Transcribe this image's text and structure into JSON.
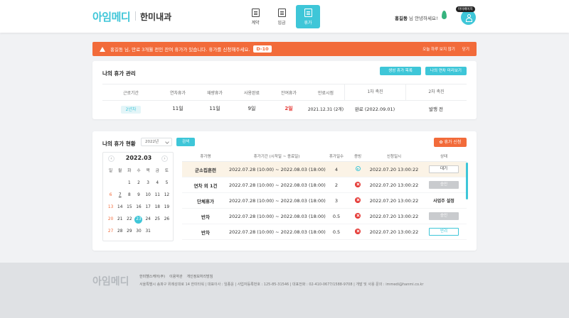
{
  "header": {
    "brand": "아임메디",
    "brand_sub": "한미내과",
    "nav": [
      {
        "label": "계약",
        "icon": "document-icon"
      },
      {
        "label": "임금",
        "icon": "calculator-icon"
      },
      {
        "label": "휴가",
        "icon": "vacation-icon"
      }
    ],
    "greeting_name": "홍길동",
    "greeting_suffix": "님 안녕하세요!",
    "profile_badge": "마이페이지"
  },
  "alert": {
    "text": "홍길동 님, 만료 3개월 전인 잔여 휴가가 있습니다. 휴가를 신청해주세요.",
    "dday": "D-10",
    "hide_today": "오늘 하루 보지 않기",
    "close": "닫기"
  },
  "leave_mgmt": {
    "title": "나의 휴가 관리",
    "btn_history": "생성 휴가 목록",
    "btn_annual": "나의 연차 미리보기",
    "headers": [
      "근로기간",
      "연차휴가",
      "재량휴가",
      "사용완료",
      "잔여휴가",
      "만료시점",
      "1차 촉진",
      "2차 촉진"
    ],
    "row": {
      "period": "2년차",
      "annual": "11일",
      "discretionary": "11일",
      "used": "9일",
      "remaining": "2일",
      "expiry": "2021.12.31 (2개)",
      "first_promo": "완료 (2022.09.01)",
      "second_promo": "발행 전"
    }
  },
  "leave_status": {
    "title": "나의 휴가 현황",
    "year": "2022년",
    "search": "검색",
    "apply": "휴가 신청",
    "calendar": {
      "month": "2022.03",
      "weekdays": [
        "일",
        "월",
        "화",
        "수",
        "목",
        "금",
        "토"
      ],
      "days": [
        "",
        "",
        "1",
        "2",
        "3",
        "4",
        "5",
        "6",
        "7",
        "8",
        "9",
        "10",
        "11",
        "12",
        "13",
        "14",
        "15",
        "16",
        "17",
        "18",
        "19",
        "20",
        "21",
        "22",
        "23",
        "24",
        "25",
        "26",
        "27",
        "28",
        "29",
        "30",
        "31",
        "",
        ""
      ],
      "today": "23",
      "marked": "7"
    },
    "table_headers": [
      "휴가명",
      "휴가기간 (시작일 ~ 종료일)",
      "휴가일수",
      "증빙",
      "신청일시",
      "상태"
    ],
    "rows": [
      {
        "name": "군소집훈련",
        "period": "2022.07.28 (10:00) ~ 2022.08.03 (18:00)",
        "days": "4",
        "evidence": "ok",
        "applied": "2022.07.20 13:00:22",
        "status": "대기",
        "status_type": "wait"
      },
      {
        "name": "연차 외 1건",
        "period": "2022.07.28 (10:00) ~ 2022.08.03 (18:00)",
        "days": "2",
        "evidence": "none",
        "applied": "2022.07.20 13:00:22",
        "status": "승인",
        "status_type": "gray"
      },
      {
        "name": "단체휴가",
        "period": "2022.07.28 (10:00) ~ 2022.08.03 (18:00)",
        "days": "3",
        "evidence": "none",
        "applied": "2022.07.20 13:00:22",
        "status": "사업주 설정",
        "status_type": "text"
      },
      {
        "name": "반차",
        "period": "2022.07.28 (10:00) ~ 2022.08.03 (18:00)",
        "days": "0.5",
        "evidence": "none",
        "applied": "2022.07.20 13:00:22",
        "status": "승인",
        "status_type": "gray"
      },
      {
        "name": "반차",
        "period": "2022.07.28 (10:00) ~ 2022.08.03 (18:00)",
        "days": "0.5",
        "evidence": "none",
        "applied": "2022.07.20 13:00:22",
        "status": "반려",
        "status_type": "teal"
      }
    ]
  },
  "footer": {
    "logo": "아임메디",
    "links": [
      "한미헬스케어(주)",
      "이용약관",
      "개인정보처리방침"
    ],
    "info": "서울특별시 송파구 위례성대로 14 한미타워  |  대표이사 : 임종윤  |  사업자등록번호 : 125-85-31546  |  대표전화 : 02-410-0677/1588-9708  |  개발 및 사용 문의 : immedi@hanmi.co.kr"
  }
}
